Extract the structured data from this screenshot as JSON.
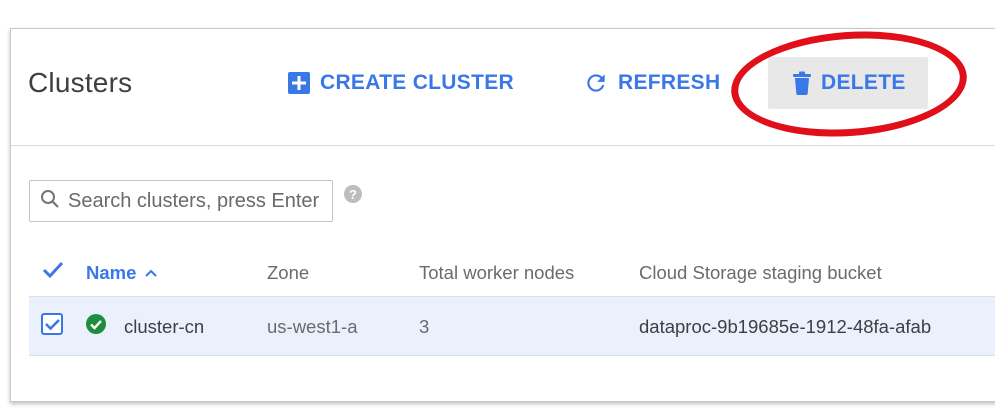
{
  "header": {
    "title": "Clusters",
    "create_label": "CREATE CLUSTER",
    "refresh_label": "REFRESH",
    "delete_label": "DELETE"
  },
  "search": {
    "placeholder": "Search clusters, press Enter"
  },
  "table": {
    "columns": [
      "Name",
      "Zone",
      "Total worker nodes",
      "Cloud Storage staging bucket"
    ],
    "sort_indicator": "^",
    "rows": [
      {
        "checked": true,
        "status": "running",
        "name": "cluster-cn",
        "zone": "us-west1-a",
        "worker_nodes": "3",
        "bucket": "dataproc-9b19685e-1912-48fa-afab"
      }
    ]
  },
  "colors": {
    "accent": "#3b78e7",
    "status_ok": "#1e8e3e",
    "highlight_circle": "#e0101a",
    "selected_row": "#eaf1fd"
  }
}
